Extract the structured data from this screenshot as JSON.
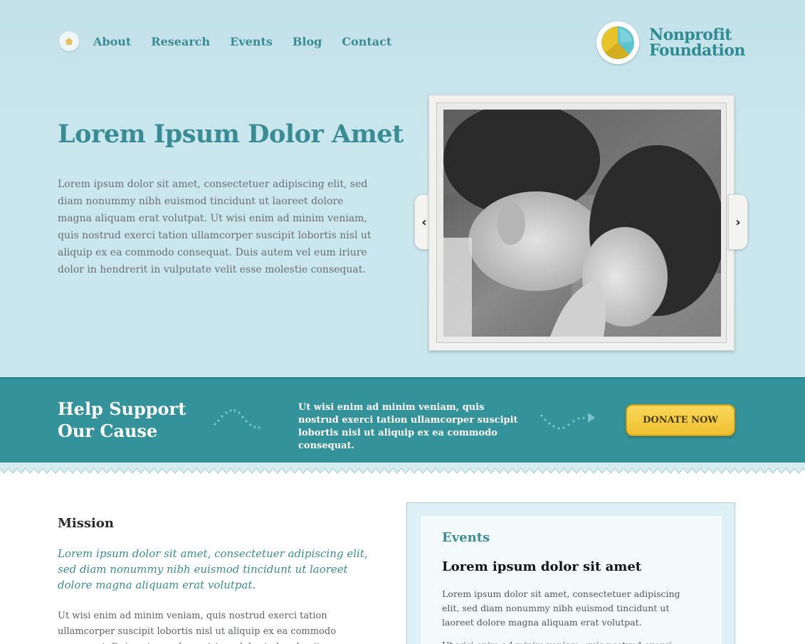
{
  "nav": {
    "home_icon": "house-icon",
    "items": [
      {
        "label": "About"
      },
      {
        "label": "Research"
      },
      {
        "label": "Events"
      },
      {
        "label": "Blog"
      },
      {
        "label": "Contact"
      }
    ]
  },
  "logo": {
    "line1": "Nonprofit",
    "line2": "Foundation",
    "colors": {
      "yellow": "#e8c42a",
      "teal": "#5cc4cf"
    }
  },
  "hero": {
    "title": "Lorem Ipsum Dolor Amet",
    "body": "Lorem ipsum dolor sit amet, consectetuer adipiscing elit, sed diam nonummy nibh euismod tincidunt ut laoreet dolore magna aliquam erat volutpat. Ut wisi enim ad minim veniam, quis nostrud exerci tation ullamcorper suscipit lobortis nisl ut aliquip ex ea commodo consequat. Duis autem vel eum iriure dolor in hendrerit in vulputate velit esse molestie consequat.",
    "slider": {
      "prev_icon": "chevron-left-icon",
      "next_icon": "chevron-right-icon",
      "prev_glyph": "‹",
      "next_glyph": "›"
    }
  },
  "band": {
    "title_line1": "Help Support",
    "title_line2": "Our Cause",
    "text": "Ut wisi enim ad minim veniam, quis nostrud exerci tation ullamcorper suscipit lobortis nisl ut aliquip ex ea commodo consequat.",
    "donate_label": "DONATE NOW",
    "color": "#34929a"
  },
  "mission": {
    "heading": "Mission",
    "lead": "Lorem ipsum dolor sit amet, consectetuer adipiscing elit, sed diam nonummy nibh euismod tincidunt ut laoreet dolore magna aliquam erat volutpat.",
    "body": "Ut wisi enim ad minim veniam, quis nostrud exerci tation ullamcorper suscipit lobortis nisl ut aliquip ex ea commodo consequat. Duis autem vel eum iriure dolor in hendrerit"
  },
  "events": {
    "heading": "Events",
    "title": "Lorem ipsum dolor sit amet",
    "body": "Lorem ipsum dolor sit amet, consectetuer adipiscing elit, sed diam nonummy nibh euismod tincidunt ut laoreet dolore magna aliquam erat volutpat.",
    "body2": "Ut wisi enim ad minim veniam, quis nostrud exerci tation"
  }
}
